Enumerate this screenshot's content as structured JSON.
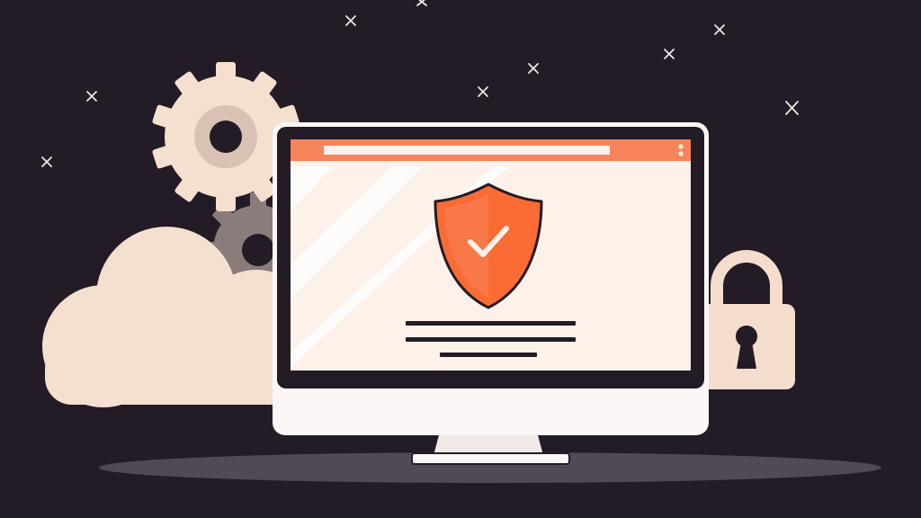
{
  "colors": {
    "background": "#231b26",
    "cream": "#f5dfcf",
    "screen": "#fdf1e9",
    "accent_orange": "#f7845a",
    "shield_orange": "#fb6b34",
    "gear_gray": "#8a7c7b",
    "gear_hub": "#d9c2b4",
    "outline": "#2b1f28",
    "monitor_white": "#fbf7f6",
    "shadow": "#514a55",
    "lock_body": "#f4ddcc"
  },
  "icons": {
    "shield": "shield-check-icon",
    "lock": "padlock-icon",
    "gear": "gear-icon",
    "cloud": "cloud-icon",
    "sparkle": "sparkle-x-icon",
    "menu": "vertical-dots-icon"
  }
}
